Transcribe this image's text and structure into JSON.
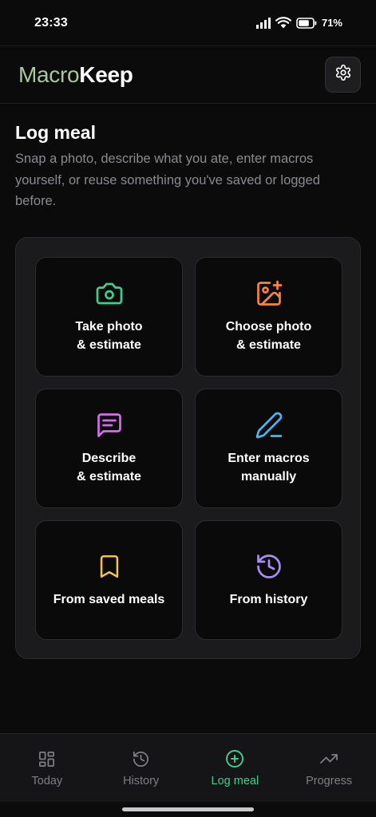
{
  "status_bar": {
    "time": "23:33",
    "battery": "71%",
    "icons": [
      "signal-icon",
      "wifi-icon",
      "battery-icon"
    ]
  },
  "header": {
    "logo_part1": "Macro",
    "logo_part2": "Keep",
    "settings_icon": "gear-icon"
  },
  "page": {
    "title": "Log meal",
    "subtitle": "Snap a photo, describe what you ate, enter macros yourself, or reuse something you've saved or logged before."
  },
  "options": [
    {
      "label": "Take photo\n& estimate",
      "icon": "camera-icon",
      "color": "#3ecf8e"
    },
    {
      "label": "Choose photo\n& estimate",
      "icon": "image-plus-icon",
      "color": "#f5853f"
    },
    {
      "label": "Describe\n& estimate",
      "icon": "message-text-icon",
      "color": "#d36ee8"
    },
    {
      "label": "Enter macros\nmanually",
      "icon": "pencil-icon",
      "color": "#4fb3f0"
    },
    {
      "label": "From saved meals",
      "icon": "bookmark-icon",
      "color": "#f2c14e"
    },
    {
      "label": "From history",
      "icon": "history-icon",
      "color": "#a98bf5"
    }
  ],
  "nav": {
    "items": [
      {
        "label": "Today",
        "icon": "grid-icon",
        "active": false
      },
      {
        "label": "History",
        "icon": "history-icon",
        "active": false
      },
      {
        "label": "Log meal",
        "icon": "plus-circle-icon",
        "active": true
      },
      {
        "label": "Progress",
        "icon": "trending-up-icon",
        "active": false
      }
    ],
    "active_color": "#3ecf8e",
    "inactive_color": "#7e7e84"
  }
}
